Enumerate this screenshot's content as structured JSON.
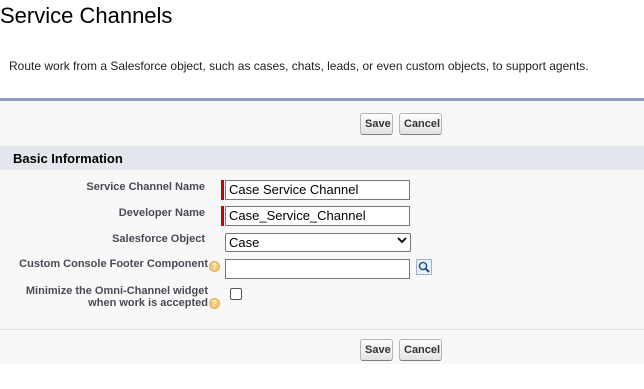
{
  "page": {
    "title": "Service Channels",
    "description": "Route work from a Salesforce object, such as cases, chats, leads, or even custom objects, to support agents."
  },
  "buttons": {
    "save_label": "Save",
    "cancel_label": "Cancel"
  },
  "section": {
    "title": "Basic Information"
  },
  "fields": {
    "service_channel_name": {
      "label": "Service Channel Name",
      "value": "Case Service Channel",
      "required": true
    },
    "developer_name": {
      "label": "Developer Name",
      "value": "Case_Service_Channel",
      "required": true
    },
    "salesforce_object": {
      "label": "Salesforce Object",
      "value": "Case"
    },
    "custom_console_footer": {
      "label": "Custom Console Footer Component",
      "value": ""
    },
    "minimize_widget": {
      "label_line1": "Minimize the Omni-Channel widget",
      "label_line2": "when work is accepted",
      "checked": false
    }
  },
  "icons": {
    "help": "help-icon",
    "lookup": "magnifier-lookup-icon",
    "dropdown": "chevron-down-icon"
  },
  "colors": {
    "required": "#cc0000",
    "header_border": "#8e9dbb",
    "section_bg": "#e3e8ef"
  }
}
